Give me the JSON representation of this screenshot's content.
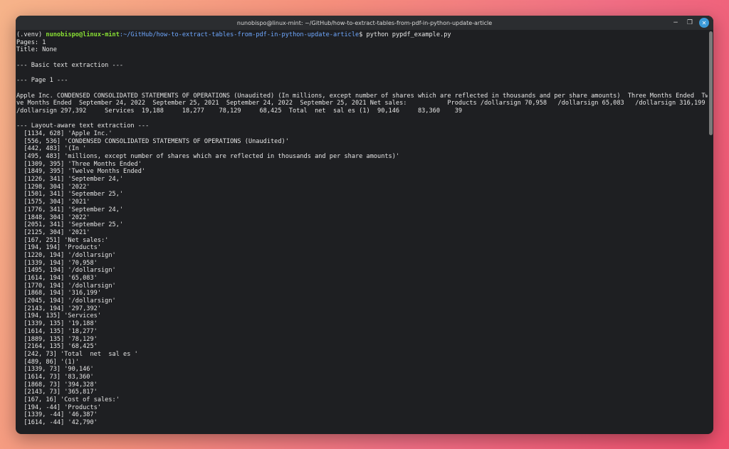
{
  "window": {
    "title": "nunobispo@linux-mint: ~/GitHub/how-to-extract-tables-from-pdf-in-python-update-article",
    "controls": {
      "minimize": "−",
      "maximize": "❐",
      "close": "✕"
    }
  },
  "prompt": {
    "venv": "(.venv) ",
    "user_host": "nunobispo@linux-mint",
    "path": ":~/GitHub/how-to-extract-tables-from-pdf-in-python-update-article",
    "command": "$ python pypdf_example.py"
  },
  "output": [
    "Pages: 1",
    "Title: None",
    "",
    "--- Basic text extraction ---",
    "",
    "--- Page 1 ---",
    "",
    "Apple Inc. CONDENSED CONSOLIDATED STATEMENTS OF OPERATIONS (Unaudited) (In millions, except number of shares which are reflected in thousands and per share amounts)  Three Months Ended  Twel",
    "ve Months Ended  September 24, 2022  September 25, 2021  September 24, 2022  September 25, 2021 Net sales:           Products /dollarsign 70,958   /dollarsign 65,083   /dollarsign 316,199",
    "/dollarsign 297,392     Services  19,188     18,277    78,129     68,425  Total  net  sal es (1)  90,146     83,360    39",
    "",
    "--- Layout-aware text extraction ---",
    "  [1134, 628] 'Apple Inc.'",
    "  [556, 536] 'CONDENSED CONSOLIDATED STATEMENTS OF OPERATIONS (Unaudited)'",
    "  [442, 483] '(In '",
    "  [495, 483] 'millions, except number of shares which are reflected in thousands and per share amounts)'",
    "  [1309, 395] 'Three Months Ended'",
    "  [1849, 395] 'Twelve Months Ended'",
    "  [1226, 341] 'September 24,'",
    "  [1298, 304] '2022'",
    "  [1501, 341] 'September 25,'",
    "  [1575, 304] '2021'",
    "  [1776, 341] 'September 24,'",
    "  [1848, 304] '2022'",
    "  [2051, 341] 'September 25,'",
    "  [2125, 304] '2021'",
    "  [167, 251] 'Net sales:'",
    "  [194, 194] 'Products'",
    "  [1220, 194] '/dollarsign'",
    "  [1339, 194] '70,958'",
    "  [1495, 194] '/dollarsign'",
    "  [1614, 194] '65,083'",
    "  [1770, 194] '/dollarsign'",
    "  [1868, 194] '316,199'",
    "  [2045, 194] '/dollarsign'",
    "  [2143, 194] '297,392'",
    "  [194, 135] 'Services'",
    "  [1339, 135] '19,188'",
    "  [1614, 135] '18,277'",
    "  [1889, 135] '78,129'",
    "  [2164, 135] '68,425'",
    "  [242, 73] 'Total  net  sal es '",
    "  [489, 86] '(1)'",
    "  [1339, 73] '90,146'",
    "  [1614, 73] '83,360'",
    "  [1868, 73] '394,328'",
    "  [2143, 73] '365,817'",
    "  [167, 16] 'Cost of sales:'",
    "  [194, -44] 'Products'",
    "  [1339, -44] '46,387'",
    "  [1614, -44] '42,790'"
  ]
}
